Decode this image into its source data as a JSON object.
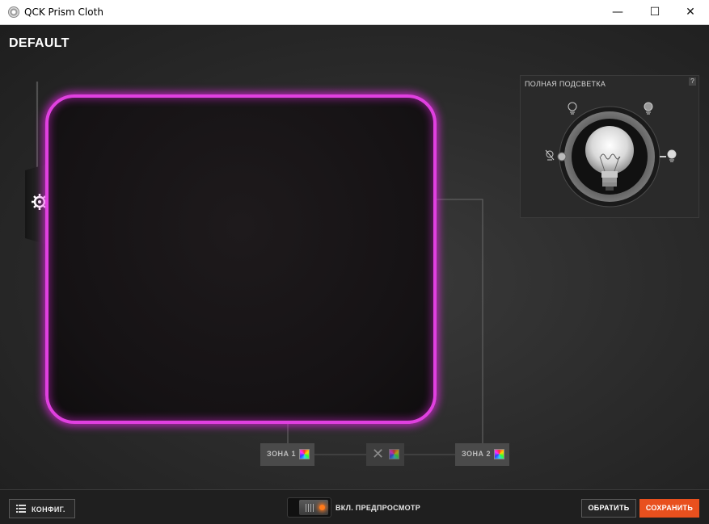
{
  "window": {
    "title": "QCK Prism Cloth",
    "minimize_glyph": "—",
    "maximize_glyph": "☐",
    "close_glyph": "✕"
  },
  "profile": {
    "name": "DEFAULT"
  },
  "colors": {
    "accent": "#e8501e",
    "glow": "#e040e0",
    "led": "#ff7a1a"
  },
  "zones": [
    {
      "label": "ЗОНА 1",
      "icon": "color-swatch-icon"
    },
    {
      "label": "",
      "icon": "disabled-x-icon"
    },
    {
      "label": "ЗОНА 2",
      "icon": "color-swatch-icon"
    }
  ],
  "brightness_panel": {
    "title": "ПОЛНАЯ ПОДСВЕТКА",
    "help": "?",
    "level": 1.0
  },
  "bottom_bar": {
    "config_label": "КОНФИГ.",
    "preview_label": "ВКЛ. ПРЕДПРОСМОТР",
    "revert_label": "ОБРАТИТЬ",
    "save_label": "СОХРАНИТЬ"
  }
}
